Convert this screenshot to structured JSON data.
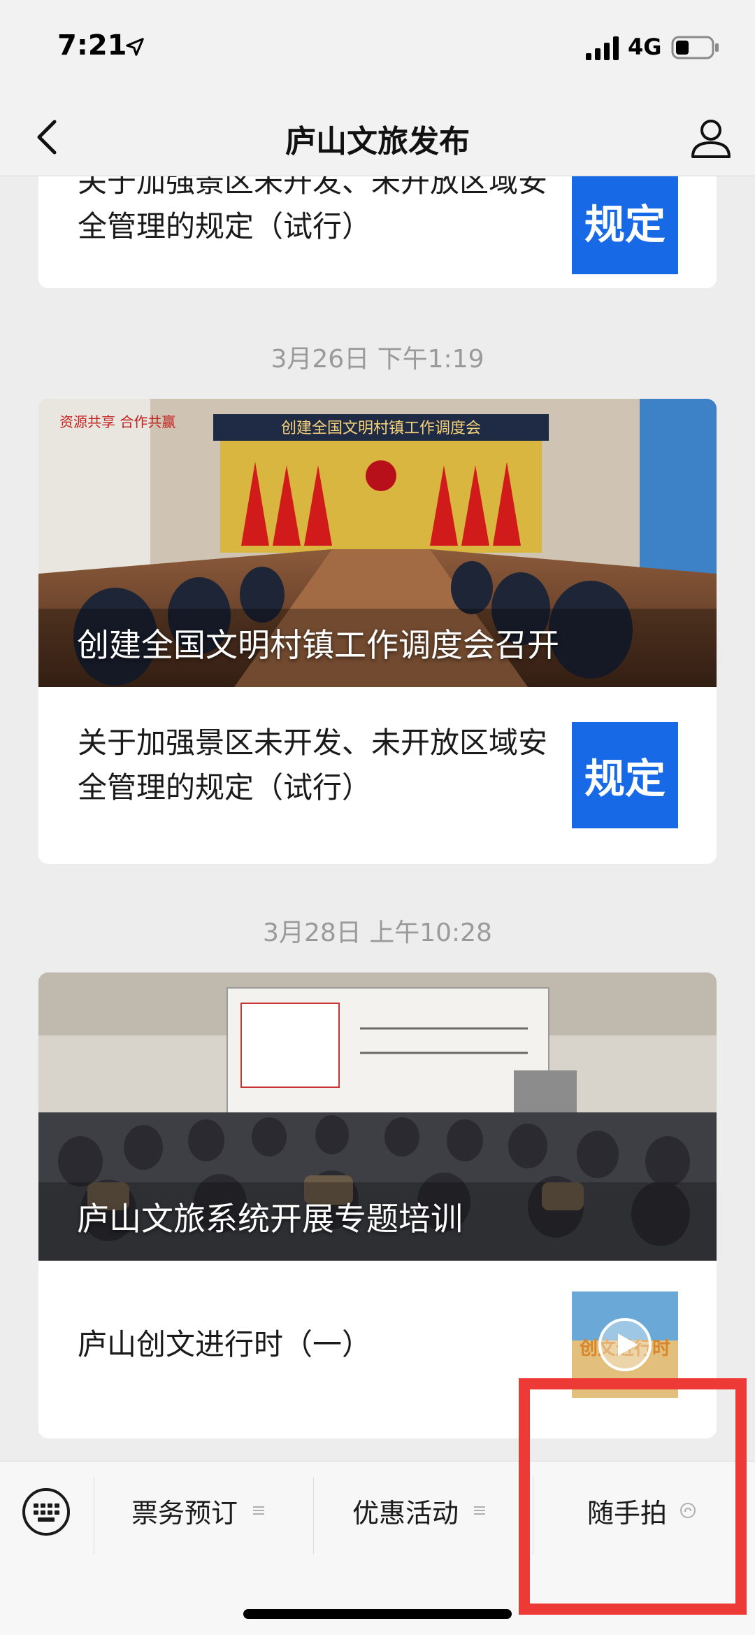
{
  "status_bar": {
    "time": "7:21",
    "network": "4G"
  },
  "nav": {
    "title": "庐山文旅发布"
  },
  "articles": [
    {
      "subtitle": "关于加强景区未开发、未开放区域安全管理的规定（试行）",
      "thumb_label": "规定"
    },
    {
      "timestamp": "3月26日 下午1:19",
      "cover_title": "创建全国文明村镇工作调度会召开",
      "cover_banner": "创建全国文明村镇工作调度会",
      "cover_wall_text": "资源共享 合作共赢",
      "subtitle": "关于加强景区未开发、未开放区域安全管理的规定（试行）",
      "thumb_label": "规定"
    },
    {
      "timestamp": "3月28日 上午10:28",
      "cover_title": "庐山文旅系统开展专题培训",
      "subtitle": "庐山创文进行时（一）",
      "thumb_label": "创文进行时"
    }
  ],
  "bottom_menu": {
    "items": [
      {
        "label": "票务预订"
      },
      {
        "label": "优惠活动"
      },
      {
        "label": "随手拍"
      }
    ]
  },
  "colors": {
    "accent_blue": "#1769e6",
    "highlight_red": "#ee3a36"
  }
}
